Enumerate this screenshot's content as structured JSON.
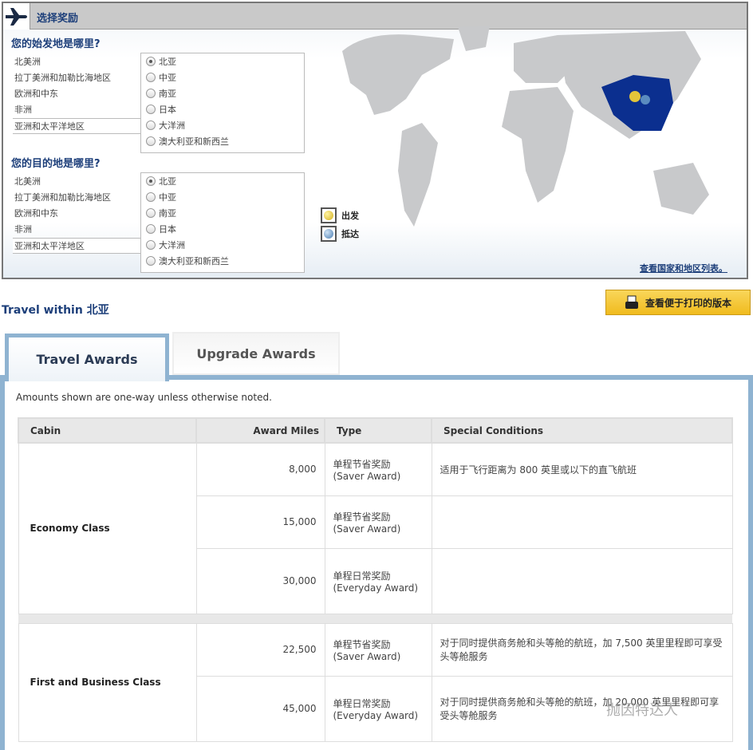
{
  "header": {
    "title": "选择奖励",
    "icon": "airplane-icon"
  },
  "origin": {
    "question": "您的始发地是哪里?",
    "regions": [
      "北美洲",
      "拉丁美洲和加勒比海地区",
      "欧洲和中东",
      "非洲",
      "亚洲和太平洋地区"
    ],
    "selected_region": "亚洲和太平洋地区",
    "subregions": [
      "北亚",
      "中亚",
      "南亚",
      "日本",
      "大洋洲",
      "澳大利亚和新西兰"
    ],
    "selected_subregion": "北亚"
  },
  "destination": {
    "question": "您的目的地是哪里?",
    "regions": [
      "北美洲",
      "拉丁美洲和加勒比海地区",
      "欧洲和中东",
      "非洲",
      "亚洲和太平洋地区"
    ],
    "selected_region": "亚洲和太平洋地区",
    "subregions": [
      "北亚",
      "中亚",
      "南亚",
      "日本",
      "大洋洲",
      "澳大利亚和新西兰"
    ],
    "selected_subregion": "北亚"
  },
  "map": {
    "legend": [
      {
        "label": "出发",
        "color": "#e2c53a"
      },
      {
        "label": "抵达",
        "color": "#5b8cc0"
      }
    ],
    "highlight_color": "#0b2f8f",
    "link": "查看国家和地区列表。"
  },
  "travel_title": "Travel within 北亚",
  "print_button": "查看便于打印的版本",
  "tabs": [
    {
      "label": "Travel Awards",
      "active": true
    },
    {
      "label": "Upgrade Awards",
      "active": false
    }
  ],
  "note": "Amounts shown are one-way unless otherwise noted.",
  "table": {
    "headers": [
      "Cabin",
      "Award Miles",
      "Type",
      "Special Conditions"
    ],
    "groups": [
      {
        "cabin": "Economy Class",
        "rows": [
          {
            "miles": "8,000",
            "type_cn": "单程节省奖励",
            "type_en": "(Saver Award)",
            "conditions": "适用于飞行距离为 800 英里或以下的直飞航班"
          },
          {
            "miles": "15,000",
            "type_cn": "单程节省奖励",
            "type_en": "(Saver Award)",
            "conditions": ""
          },
          {
            "miles": "30,000",
            "type_cn": "单程日常奖励",
            "type_en": "(Everyday Award)",
            "conditions": ""
          }
        ]
      },
      {
        "cabin": "First and Business Class",
        "rows": [
          {
            "miles": "22,500",
            "type_cn": "单程节省奖励",
            "type_en": "(Saver Award)",
            "conditions": "对于同时提供商务舱和头等舱的航班，加 7,500 英里里程即可享受头等舱服务"
          },
          {
            "miles": "45,000",
            "type_cn": "单程日常奖励",
            "type_en": "(Everyday Award)",
            "conditions": "对于同时提供商务舱和头等舱的航班，加 20,000 英里里程即可享受头等舱服务"
          }
        ]
      }
    ]
  },
  "watermark": "抛因特达人"
}
